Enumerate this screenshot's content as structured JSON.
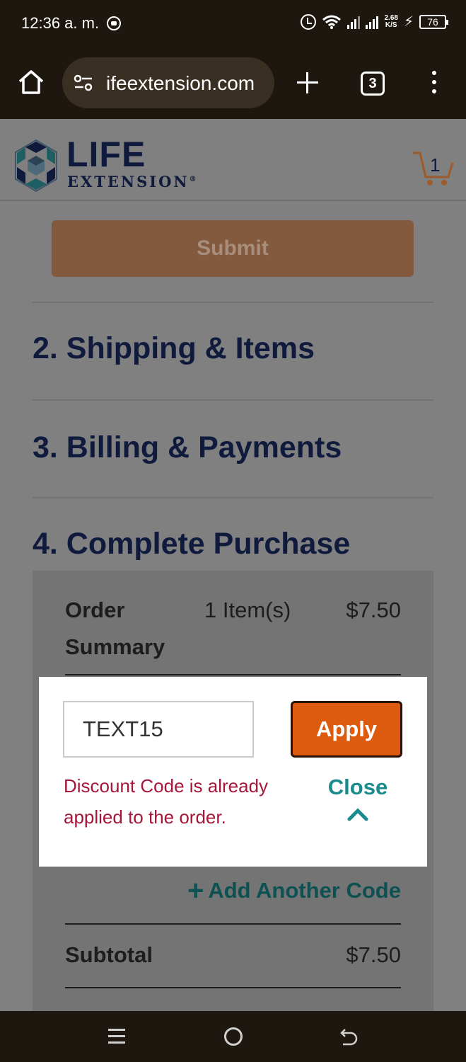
{
  "status_bar": {
    "time": "12:36 a. m.",
    "net_speed_value": "2.68",
    "net_speed_unit": "K/S",
    "battery": "76"
  },
  "browser": {
    "url": "ifeextension.com",
    "tab_count": "3"
  },
  "site": {
    "logo_line1": "LIFE",
    "logo_line2": "EXTENSION",
    "logo_mark": "®",
    "cart_count": "1",
    "brand_colors": {
      "navy": "#0f1a3d",
      "orange": "#dc5b0e",
      "teal": "#1a8a8c"
    }
  },
  "checkout": {
    "submit_label": "Submit",
    "steps": [
      {
        "label": "2. Shipping & Items"
      },
      {
        "label": "3. Billing & Payments"
      },
      {
        "label": "4. Complete Purchase"
      }
    ],
    "order_summary": {
      "label": "Order Summary",
      "item_count": "1 Item(s)",
      "total": "$7.50"
    },
    "discount": {
      "input_value": "TEXT15",
      "apply_label": "Apply",
      "error": "Discount Code is already applied to the order.",
      "close_label": "Close",
      "add_another_label": "Add Another Code"
    },
    "subtotal_label": "Subtotal",
    "subtotal_value": "$7.50"
  }
}
